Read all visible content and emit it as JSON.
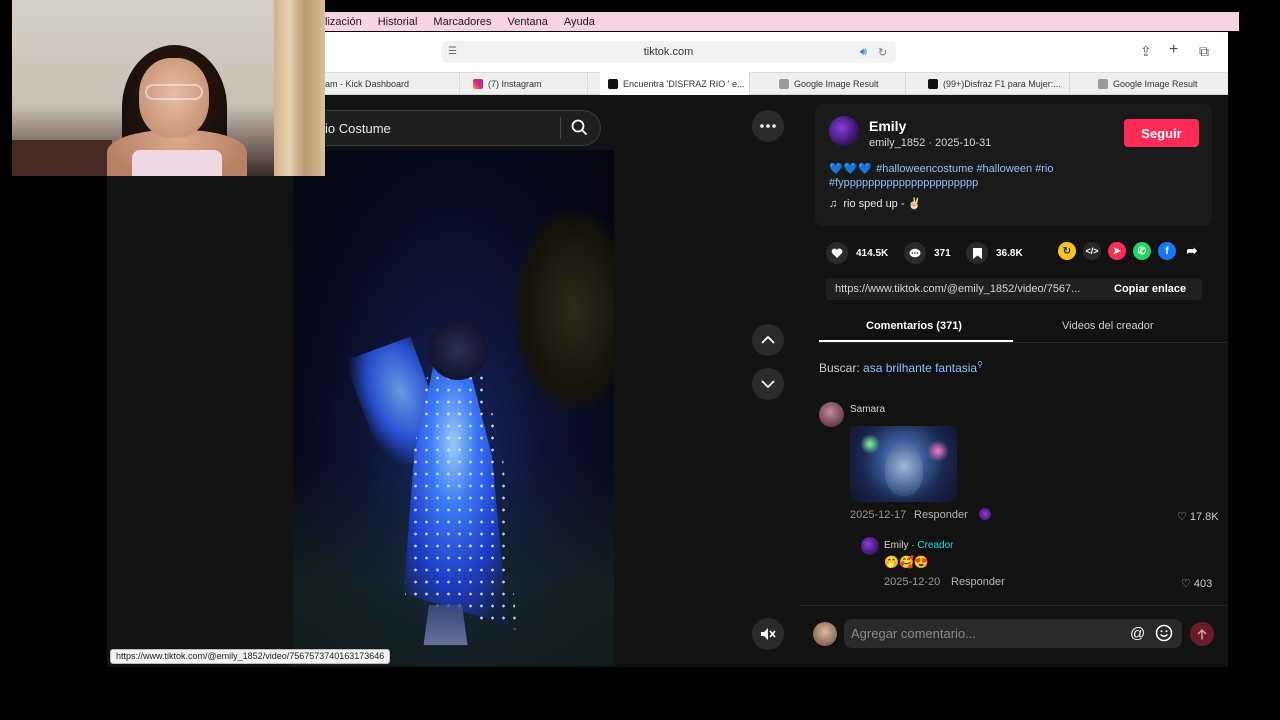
{
  "menubar": {
    "items": [
      "lización",
      "Historial",
      "Marcadores",
      "Ventana",
      "Ayuda"
    ]
  },
  "browser": {
    "url": "tiktok.com",
    "tabs": [
      {
        "label": "am - Kick Dashboard",
        "icon": "kick-favicon"
      },
      {
        "label": "(7) Instagram",
        "icon": "instagram-favicon"
      },
      {
        "label": "Encuentra 'DISFRAZ RIO ' e...",
        "icon": "tiktok-favicon"
      },
      {
        "label": "Google Image Result",
        "icon": "google-favicon"
      },
      {
        "label": "(99+)Disfraz F1 para Mujer:...",
        "icon": "tiktok-favicon"
      },
      {
        "label": "Google Image Result",
        "icon": "google-favicon"
      }
    ],
    "status_url": "https://www.tiktok.com/@emily_1852/video/7567573740163173646"
  },
  "search": {
    "query": "io Costume"
  },
  "video": {
    "mute_icon": "muted-speaker-icon"
  },
  "profile": {
    "name": "Emily",
    "handle_date": "emily_1852 · 2025-10-31",
    "follow_label": "Seguir",
    "caption_hearts": "💙💙💙",
    "caption_tags": "#halloweencostume #halloween #rio #fypppppppppppppppppppppp",
    "sound": "rio sped up - ✌🏻"
  },
  "stats": {
    "likes": "414.5K",
    "comments": "371",
    "saves": "36.8K"
  },
  "share_link": {
    "url": "https://www.tiktok.com/@emily_1852/video/7567...",
    "copy_label": "Copiar enlace"
  },
  "panel_tabs": {
    "comments": "Comentarios (371)",
    "creator_videos": "Videos del creador"
  },
  "search_suggestion": {
    "prefix": "Buscar:",
    "term": "asa brilhante fantasia"
  },
  "comments": [
    {
      "author": "Samara",
      "date": "2025-12-17",
      "reply_label": "Responder",
      "likes": "17.8K"
    }
  ],
  "reply": {
    "author": "Emily",
    "badge": "Creador",
    "text": "🤭🥰😍",
    "date": "2025-12-20",
    "reply_label": "Responder",
    "likes": "403"
  },
  "comment_input": {
    "placeholder": "Agregar comentario..."
  },
  "colors": {
    "accent": "#fe2c55",
    "link": "#8fc2ff",
    "creator": "#25d9e0",
    "menubar": "#f7d3e3"
  }
}
